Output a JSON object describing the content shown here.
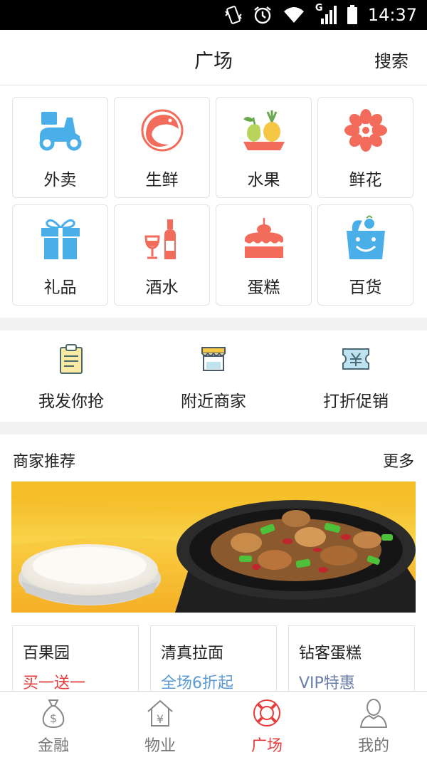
{
  "status_bar": {
    "time": "14:37",
    "network": "G"
  },
  "nav": {
    "title": "广场",
    "search_label": "搜索"
  },
  "categories": [
    {
      "label": "外卖",
      "icon": "scooter-icon",
      "color": "#4aaee8"
    },
    {
      "label": "生鲜",
      "icon": "shrimp-icon",
      "color": "#f26b5b"
    },
    {
      "label": "水果",
      "icon": "fruit-icon",
      "color": "#8cc152"
    },
    {
      "label": "鲜花",
      "icon": "flower-icon",
      "color": "#f26b5b"
    },
    {
      "label": "礼品",
      "icon": "gift-box-icon",
      "color": "#4aaee8"
    },
    {
      "label": "酒水",
      "icon": "wine-icon",
      "color": "#f26b5b"
    },
    {
      "label": "蛋糕",
      "icon": "cake-icon",
      "color": "#f26b5b"
    },
    {
      "label": "百货",
      "icon": "shopping-bag-icon",
      "color": "#4aaee8"
    }
  ],
  "quick_actions": [
    {
      "label": "我发你抢",
      "icon": "clipboard-icon"
    },
    {
      "label": "附近商家",
      "icon": "storefront-icon"
    },
    {
      "label": "打折促销",
      "icon": "coupon-icon"
    }
  ],
  "recommend": {
    "title": "商家推荐",
    "more_label": "更多",
    "shops": [
      {
        "name": "百果园",
        "promo": "买一送一",
        "promo_color": "#e83b3b"
      },
      {
        "name": "清真拉面",
        "promo": "全场6折起",
        "promo_color": "#5b9bd5"
      },
      {
        "name": "钻客蛋糕",
        "promo": "VIP特惠",
        "promo_color": "#6b7fa8"
      }
    ]
  },
  "tabs": [
    {
      "label": "金融",
      "icon": "money-bag-icon",
      "active": false
    },
    {
      "label": "物业",
      "icon": "house-yen-icon",
      "active": false
    },
    {
      "label": "广场",
      "icon": "lifebuoy-icon",
      "active": true
    },
    {
      "label": "我的",
      "icon": "user-icon",
      "active": false
    }
  ],
  "colors": {
    "accent": "#e83b3b",
    "tab_inactive": "#777777"
  }
}
